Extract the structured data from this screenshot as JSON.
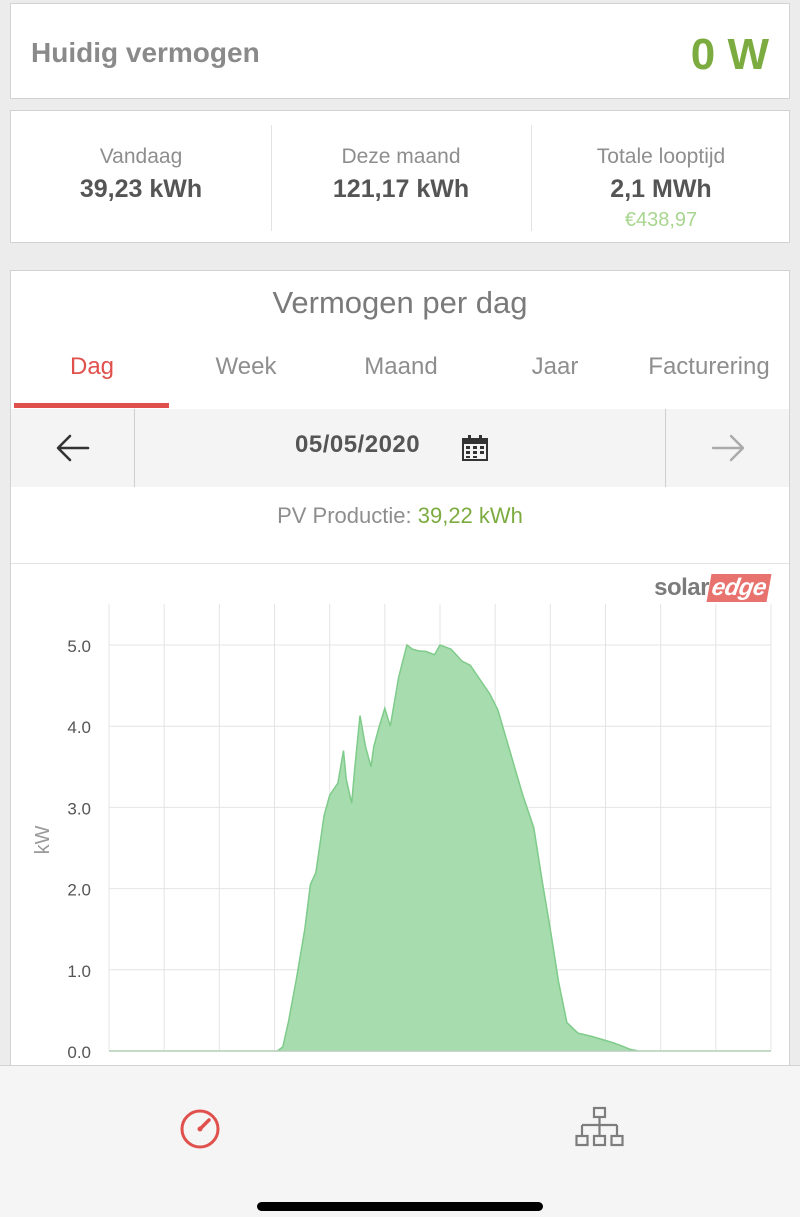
{
  "power": {
    "label": "Huidig vermogen",
    "value": "0 W"
  },
  "energy": [
    {
      "title": "Vandaag",
      "value": "39,23 kWh",
      "money": ""
    },
    {
      "title": "Deze maand",
      "value": "121,17 kWh",
      "money": ""
    },
    {
      "title": "Totale looptijd",
      "value": "2,1 MWh",
      "money": "€438,97"
    }
  ],
  "chart_panel": {
    "title": "Vermogen per dag",
    "tabs": [
      "Dag",
      "Week",
      "Maand",
      "Jaar",
      "Facturering"
    ],
    "active_tab": "Dag",
    "date": "05/05/2020",
    "pv_label": "PV Productie:",
    "pv_value": "39,22 kWh",
    "logo": {
      "solar": "solar",
      "edge": "edge"
    }
  },
  "colors": {
    "accent": "#e0504c",
    "green": "#7cac3f",
    "area_fill": "#a7dcae",
    "area_stroke": "#7ecb8a"
  },
  "icons": {
    "prev": "arrow-left-icon",
    "next": "arrow-right-icon",
    "calendar": "calendar-icon",
    "dashboard": "gauge-icon",
    "layout": "site-tree-icon"
  },
  "chart_data": {
    "type": "area",
    "ylabel": "kW",
    "ylim": [
      0,
      5.5
    ],
    "yticks": [
      "0.0",
      "1.0",
      "2.0",
      "3.0",
      "4.0",
      "5.0"
    ],
    "xlim": [
      0,
      24
    ],
    "grid": true,
    "series": [
      {
        "x": [
          0,
          6.1,
          6.3,
          6.5,
          6.8,
          7.1,
          7.3,
          7.5,
          7.8,
          8.0,
          8.3,
          8.5,
          8.6,
          8.8,
          8.9,
          9.1,
          9.3,
          9.5,
          9.6,
          9.8,
          10.0,
          10.2,
          10.5,
          10.8,
          11.0,
          11.2,
          11.5,
          11.8,
          12.0,
          12.4,
          12.8,
          13.1,
          13.4,
          13.8,
          14.1,
          14.4,
          14.7,
          15.0,
          15.4,
          15.7,
          16.0,
          16.3,
          16.6,
          17.0,
          17.5,
          17.9,
          18.3,
          18.6,
          18.9,
          19.2,
          24
        ],
        "y": [
          0,
          0,
          0.05,
          0.35,
          0.9,
          1.5,
          2.05,
          2.2,
          2.9,
          3.15,
          3.3,
          3.7,
          3.35,
          3.05,
          3.45,
          4.13,
          3.75,
          3.5,
          3.75,
          4.0,
          4.22,
          4.0,
          4.6,
          5.0,
          4.95,
          4.93,
          4.92,
          4.88,
          5.0,
          4.95,
          4.8,
          4.75,
          4.6,
          4.4,
          4.2,
          3.85,
          3.5,
          3.15,
          2.75,
          2.1,
          1.5,
          0.85,
          0.35,
          0.22,
          0.18,
          0.14,
          0.1,
          0.06,
          0.02,
          0,
          0
        ]
      }
    ]
  }
}
